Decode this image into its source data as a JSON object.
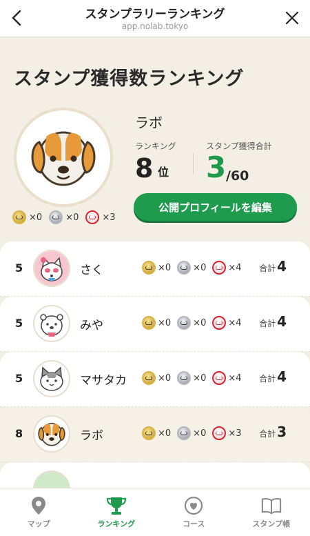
{
  "header": {
    "title": "スタンプラリーランキング",
    "url": "app.nolab.tokyo"
  },
  "profile": {
    "headline": "スタンプ獲得数ランキング",
    "name": "ラボ",
    "rank_label": "ランキング",
    "rank": "8",
    "rank_unit": "位",
    "total_label": "スタンプ獲得合計",
    "total": "3",
    "total_max": "/60",
    "button_label": "公開プロフィールを編集",
    "medals": {
      "gold": "×0",
      "silver": "×0",
      "red": "×3"
    },
    "avatar_icon": "beagle-dog-icon"
  },
  "ranking": [
    {
      "rank": "5",
      "name": "さく",
      "gold": "×0",
      "silver": "×0",
      "red": "×4",
      "sum_label": "合計",
      "sum": "4",
      "avatar_icon": "cat-with-bow-icon"
    },
    {
      "rank": "5",
      "name": "みや",
      "gold": "×0",
      "silver": "×0",
      "red": "×4",
      "sum_label": "合計",
      "sum": "4",
      "avatar_icon": "white-dog-icon"
    },
    {
      "rank": "5",
      "name": "マサタカ",
      "gold": "×0",
      "silver": "×0",
      "red": "×4",
      "sum_label": "合計",
      "sum": "4",
      "avatar_icon": "grey-cat-icon"
    },
    {
      "rank": "8",
      "name": "ラボ",
      "gold": "×0",
      "silver": "×0",
      "red": "×3",
      "sum_label": "合計",
      "sum": "3",
      "avatar_icon": "beagle-dog-icon"
    }
  ],
  "tabs": [
    {
      "label": "マップ",
      "icon": "map-pin-icon"
    },
    {
      "label": "ランキング",
      "icon": "trophy-icon"
    },
    {
      "label": "コース",
      "icon": "heart-circle-icon"
    },
    {
      "label": "スタンプ帳",
      "icon": "book-icon"
    }
  ],
  "colors": {
    "accent": "#1e9b4c",
    "background": "#f4efe4",
    "gold": "#c49a25",
    "red": "#d9232e"
  }
}
